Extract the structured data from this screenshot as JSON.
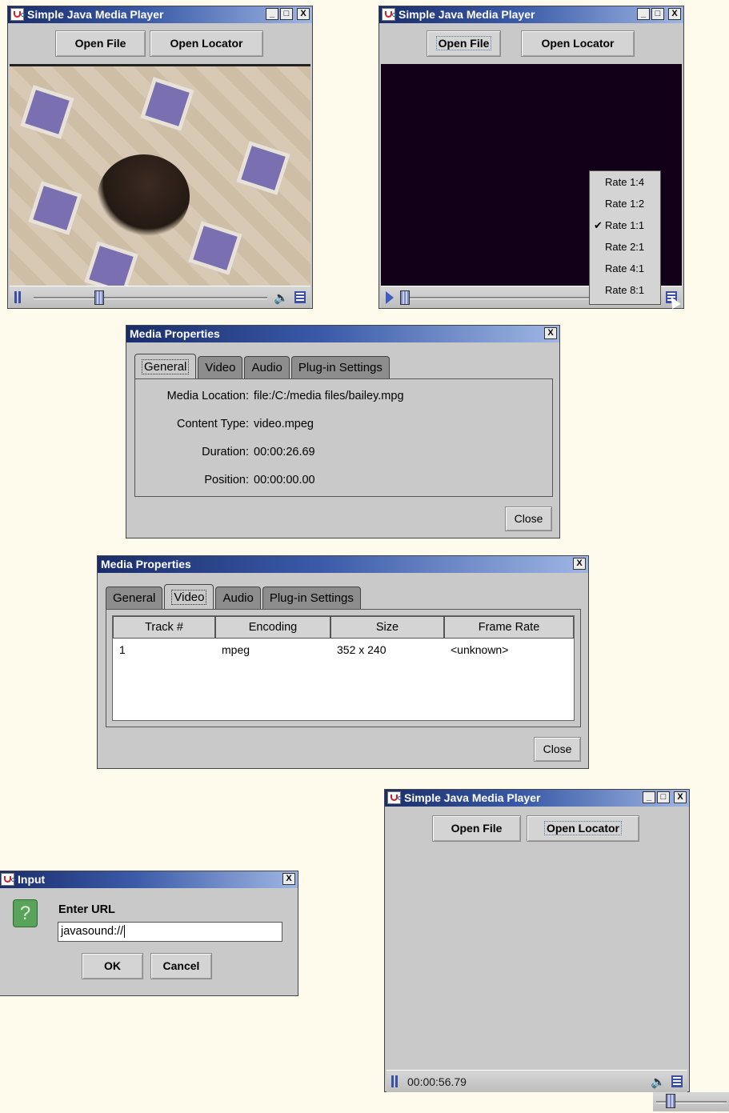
{
  "player": {
    "title": "Simple Java Media Player",
    "open_file": "Open File",
    "open_locator": "Open Locator",
    "minimize": "_",
    "maximize": "□",
    "close": "X"
  },
  "rate_menu": {
    "items": [
      "Rate 1:4",
      "Rate 1:2",
      "Rate 1:1",
      "Rate 2:1",
      "Rate 4:1",
      "Rate 8:1"
    ],
    "checked": "Rate 1:1",
    "check_glyph": "✔"
  },
  "props_general": {
    "title": "Media Properties",
    "tabs": [
      "General",
      "Video",
      "Audio",
      "Plug-in Settings"
    ],
    "selected_tab": "General",
    "rows": [
      {
        "key": "Media Location:",
        "value": "file:/C:/media files/bailey.mpg"
      },
      {
        "key": "Content Type:",
        "value": "video.mpeg"
      },
      {
        "key": "Duration:",
        "value": "00:00:26.69"
      },
      {
        "key": "Position:",
        "value": "00:00:00.00"
      }
    ],
    "close_label": "Close"
  },
  "props_video": {
    "title": "Media Properties",
    "tabs": [
      "General",
      "Video",
      "Audio",
      "Plug-in Settings"
    ],
    "selected_tab": "Video",
    "columns": [
      "Track #",
      "Encoding",
      "Size",
      "Frame Rate"
    ],
    "rows": [
      [
        "1",
        "mpeg",
        "352 x 240",
        "<unknown>"
      ]
    ],
    "close_label": "Close"
  },
  "input_dialog": {
    "title": "Input",
    "prompt": "Enter URL",
    "value": "javasound://",
    "ok_label": "OK",
    "cancel_label": "Cancel",
    "icon": "question-icon"
  },
  "audio_player": {
    "time": "00:00:56.79"
  },
  "colors": {
    "background": "#fefbed",
    "window": "#c9c9c9",
    "title_gradient_start": "#1a2d6b",
    "title_gradient_end": "#9fb6e3",
    "video_black": "#120018"
  }
}
